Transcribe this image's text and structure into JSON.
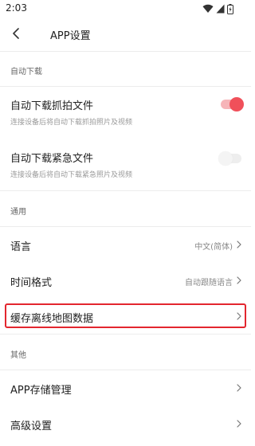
{
  "status_bar": {
    "time": "2:03",
    "icons": [
      "wifi-icon",
      "cellular-signal-icon",
      "battery-icon"
    ]
  },
  "header": {
    "back_icon": "chevron-left-icon",
    "title": "APP设置"
  },
  "sections": {
    "auto_download": {
      "header": "自动下载",
      "snapshot": {
        "title": "自动下载抓拍文件",
        "subtitle": "连接设备后将自动下载抓拍照片及视频",
        "enabled": true
      },
      "emergency": {
        "title": "自动下载紧急文件",
        "subtitle": "连接设备后将自动下载紧急照片及视频",
        "enabled": false
      }
    },
    "general": {
      "header": "通用",
      "language": {
        "title": "语言",
        "value": "中文(简体)"
      },
      "time_format": {
        "title": "时间格式",
        "value": "自动跟随语言"
      },
      "offline_map": {
        "title": "缓存离线地图数据",
        "highlighted": true
      }
    },
    "other": {
      "header": "其他",
      "storage": {
        "title": "APP存储管理"
      },
      "advanced": {
        "title": "高级设置"
      }
    }
  },
  "colors": {
    "accent": "#f0505a",
    "accent_track": "#f6b4b8",
    "highlight_border": "#e3262e",
    "divider": "#ececec",
    "secondary_text": "#9a9a9a"
  }
}
